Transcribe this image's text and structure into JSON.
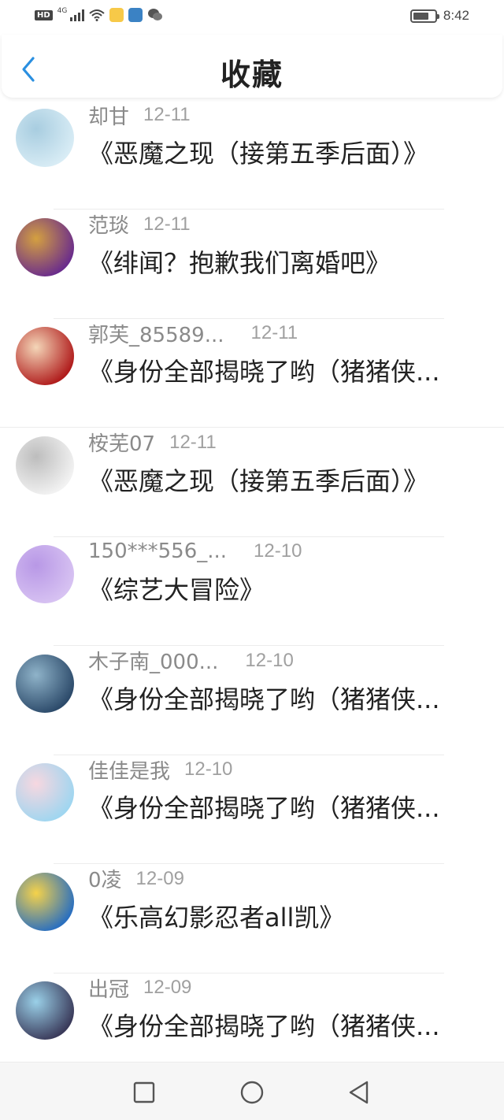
{
  "status_bar": {
    "hd": "HD",
    "network": "4G",
    "time": "8:42",
    "battery_level": 0.75
  },
  "header": {
    "title": "收藏",
    "back_icon": "chevron-left-icon"
  },
  "items": [
    {
      "username": "却甘",
      "date": "12-11",
      "title": "《恶魔之现（接第五季后面）》",
      "avatar_colors": [
        "#d8ecf5",
        "#a8cde0"
      ]
    },
    {
      "username": "范琰",
      "date": "12-11",
      "title": "《绯闻？抱歉我们离婚吧》",
      "avatar_colors": [
        "#6a2c8c",
        "#d4a040"
      ]
    },
    {
      "username": "郭芙_85589...",
      "date": "12-11",
      "title": "《身份全部揭晓了哟（猪猪侠...",
      "avatar_colors": [
        "#b01c1c",
        "#f4d6b8"
      ]
    },
    {
      "username": "桉芜07",
      "date": "12-11",
      "title": "《恶魔之现（接第五季后面）》",
      "avatar_colors": [
        "#f2f2f2",
        "#bdbdbd"
      ]
    },
    {
      "username": "150***556_...",
      "date": "12-10",
      "title": "《综艺大冒险》",
      "avatar_colors": [
        "#d7c2f2",
        "#b898e6"
      ]
    },
    {
      "username": "木子南_000...",
      "date": "12-10",
      "title": "《身份全部揭晓了哟（猪猪侠...",
      "avatar_colors": [
        "#2c4a6a",
        "#8fb3c9"
      ]
    },
    {
      "username": "佳佳是我",
      "date": "12-10",
      "title": "《身份全部揭晓了哟（猪猪侠...",
      "avatar_colors": [
        "#9fd6f0",
        "#f7d7e0"
      ]
    },
    {
      "username": "0凌",
      "date": "12-09",
      "title": "《乐高幻影忍者all凯》",
      "avatar_colors": [
        "#2a6fbf",
        "#f5d24a"
      ]
    },
    {
      "username": "出冠",
      "date": "12-09",
      "title": "《身份全部揭晓了哟（猪猪侠...",
      "avatar_colors": [
        "#3a3a5a",
        "#9ad0e8"
      ]
    }
  ],
  "nav": {
    "recent": "square-icon",
    "home": "circle-icon",
    "back": "triangle-back-icon"
  }
}
